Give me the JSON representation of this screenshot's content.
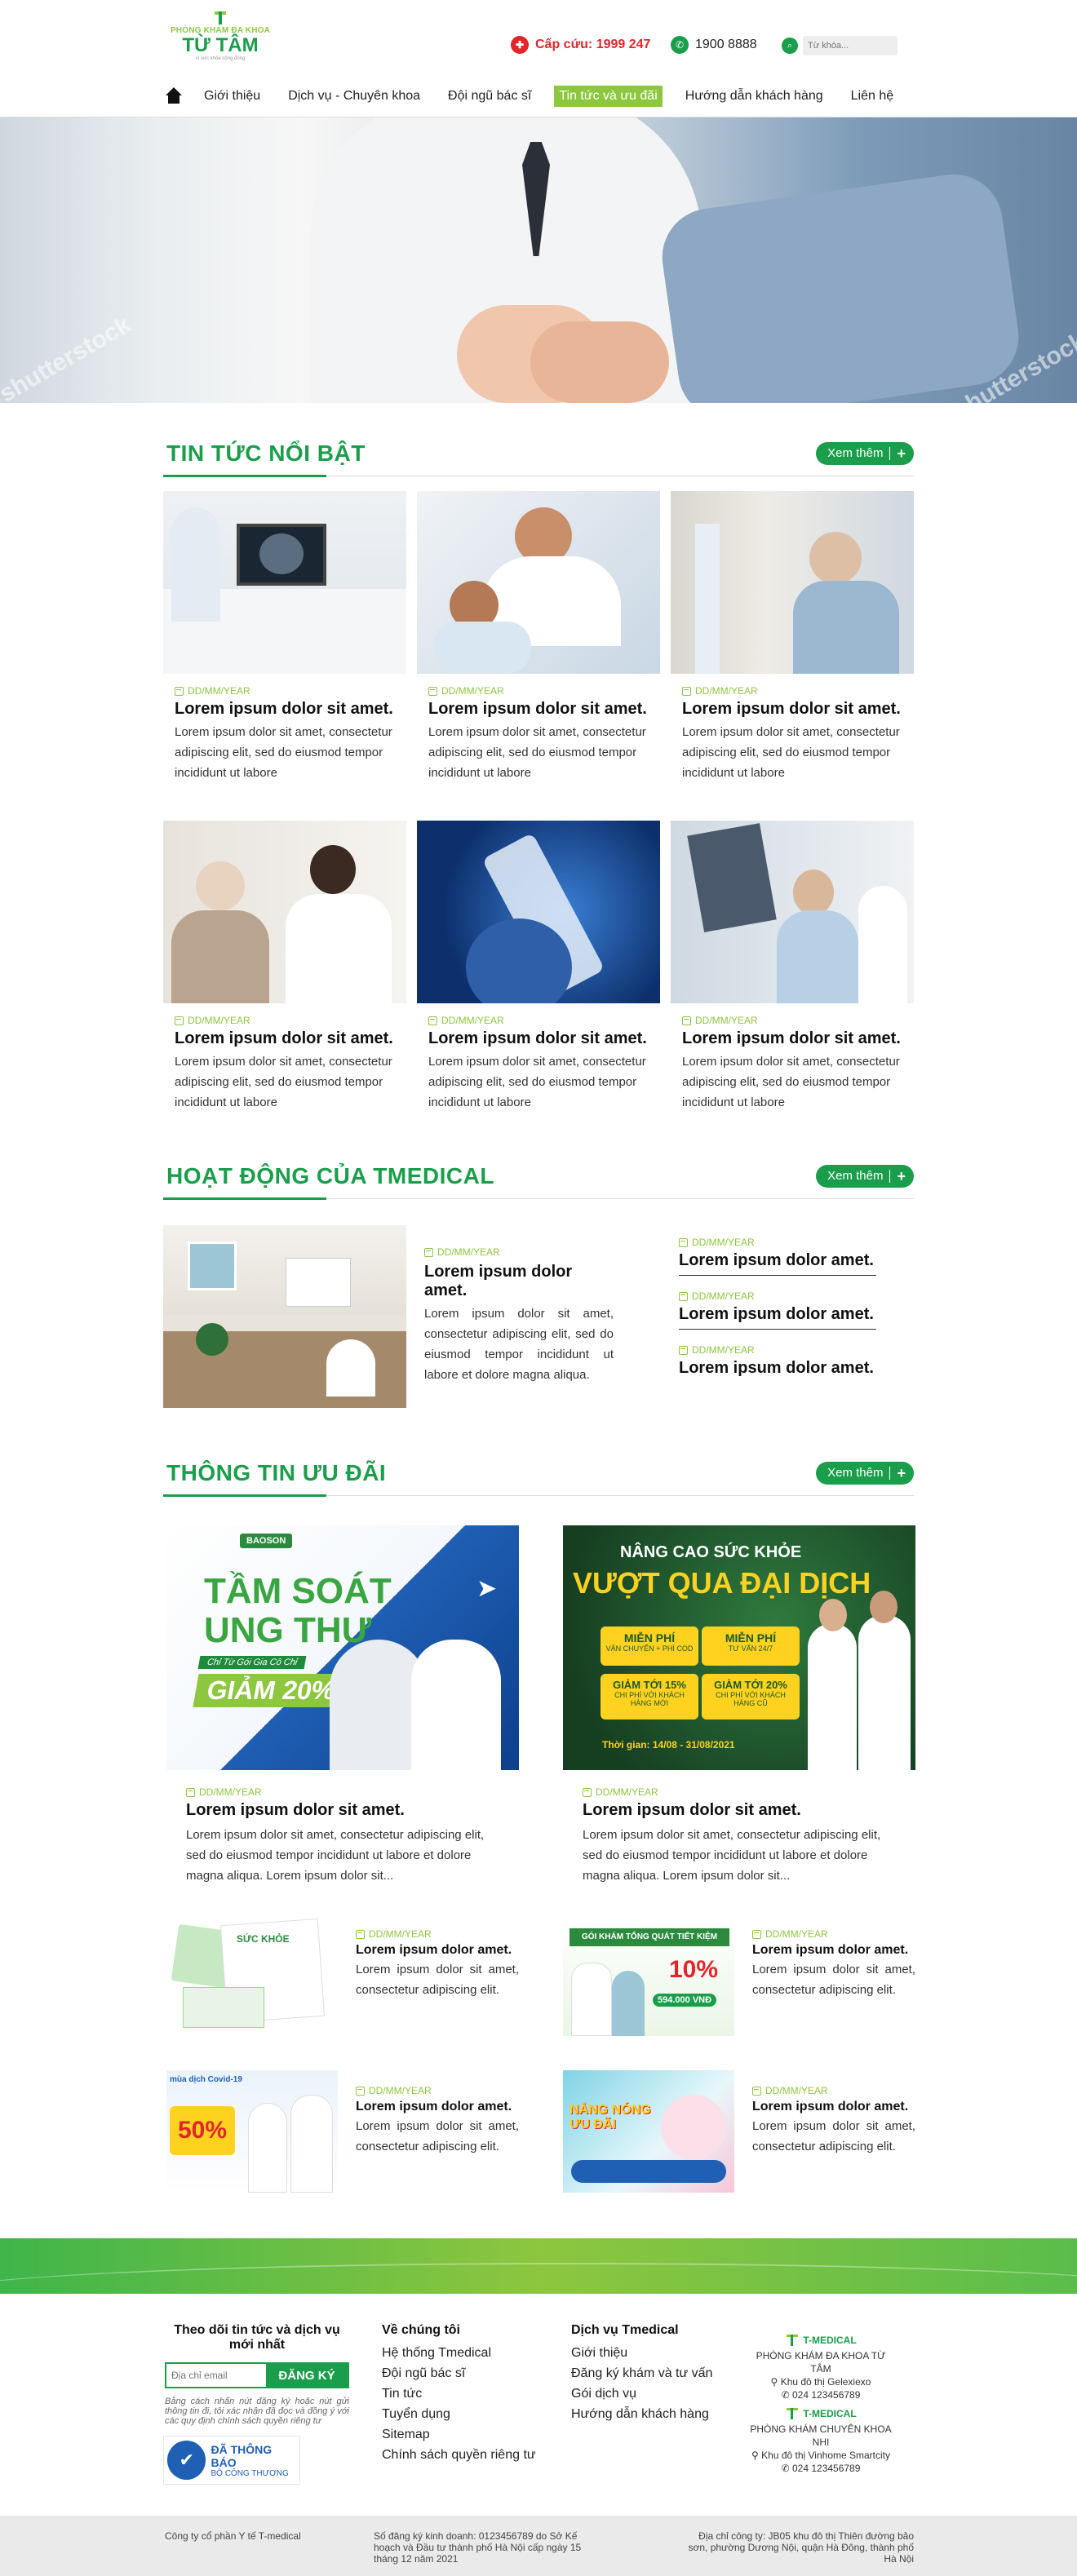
{
  "header": {
    "logo": {
      "sub": "PHÒNG KHÁM ĐA KHOA",
      "name": "TỪ TÂM",
      "tag": "vì sức khỏe cộng đồng"
    },
    "emergency": "Cấp cứu: 1999 247",
    "hotline": "1900 8888",
    "search_placeholder": "Từ khóa..."
  },
  "nav": {
    "items": [
      {
        "label": "Giới thiệu"
      },
      {
        "label": "Dịch vụ - Chuyên khoa"
      },
      {
        "label": "Đội ngũ bác sĩ"
      },
      {
        "label": "Tin tức và ưu đãi"
      },
      {
        "label": "Hướng dẫn khách hàng"
      },
      {
        "label": "Liên hệ"
      }
    ],
    "active_index": 3
  },
  "hero": {
    "watermark": "shutterstock"
  },
  "featured": {
    "title": "TIN TỨC NỔI BẬT",
    "more": "Xem thêm",
    "cards": [
      {
        "date": "DD/MM/YEAR",
        "title": "Lorem ipsum dolor sit amet.",
        "desc": "Lorem ipsum dolor sit amet, consectetur adipiscing elit, sed do eiusmod tempor incididunt ut labore",
        "image": "lab-xray-monitor"
      },
      {
        "date": "DD/MM/YEAR",
        "title": "Lorem ipsum dolor sit amet.",
        "desc": "Lorem ipsum dolor sit amet, consectetur adipiscing elit, sed do eiusmod tempor incididunt ut labore",
        "image": "mother-child-hospital"
      },
      {
        "date": "DD/MM/YEAR",
        "title": "Lorem ipsum dolor sit amet.",
        "desc": "Lorem ipsum dolor sit amet, consectetur adipiscing elit, sed do eiusmod tempor incididunt ut labore",
        "image": "elderly-patient"
      },
      {
        "date": "DD/MM/YEAR",
        "title": "Lorem ipsum dolor sit amet.",
        "desc": "Lorem ipsum dolor sit amet, consectetur adipiscing elit, sed do eiusmod tempor incididunt ut labore",
        "image": "doctor-senior-patient"
      },
      {
        "date": "DD/MM/YEAR",
        "title": "Lorem ipsum dolor sit amet.",
        "desc": "Lorem ipsum dolor sit amet, consectetur adipiscing elit, sed do eiusmod tempor incididunt ut labore",
        "image": "covid-vaccine-vial"
      },
      {
        "date": "DD/MM/YEAR",
        "title": "Lorem ipsum dolor sit amet.",
        "desc": "Lorem ipsum dolor sit amet, consectetur adipiscing elit, sed do eiusmod tempor incididunt ut labore",
        "image": "doctors-xray"
      }
    ]
  },
  "activity": {
    "title": "HOẠT ĐỘNG CỦA TMEDICAL",
    "more": "Xem thêm",
    "main": {
      "date": "DD/MM/YEAR",
      "title": "Lorem ipsum dolor amet.",
      "desc": "Lorem ipsum dolor sit amet, consectetur adipiscing elit, sed do eiusmod tempor incididunt ut labore et dolore magna aliqua."
    },
    "list": [
      {
        "date": "DD/MM/YEAR",
        "title": "Lorem ipsum dolor amet."
      },
      {
        "date": "DD/MM/YEAR",
        "title": "Lorem ipsum dolor amet."
      },
      {
        "date": "DD/MM/YEAR",
        "title": "Lorem ipsum dolor amet."
      }
    ]
  },
  "promo": {
    "title": "THÔNG TIN ƯU ĐÃI",
    "more": "Xem thêm",
    "large": [
      {
        "date": "DD/MM/YEAR",
        "title": "Lorem ipsum dolor sit amet.",
        "desc": "Lorem ipsum dolor sit amet, consectetur adipiscing elit, sed do eiusmod tempor incididunt ut labore et dolore magna aliqua. Lorem ipsum dolor sit...",
        "banner": {
          "brand": "BAOSON",
          "headline1": "TẦM SOÁT",
          "headline2": "UNG THƯ",
          "sub": "Chỉ Từ Gói Gia Cô Chỉ",
          "discount": "GIẢM 20%"
        }
      },
      {
        "date": "DD/MM/YEAR",
        "title": "Lorem ipsum dolor sit amet.",
        "desc": "Lorem ipsum dolor sit amet, consectetur adipiscing elit, sed do eiusmod tempor incididunt ut labore et dolore magna aliqua. Lorem ipsum dolor sit...",
        "banner": {
          "top": "NÂNG CAO SỨC KHỎE",
          "headline": "VƯỢT QUA ĐẠI DỊCH",
          "boxes": [
            {
              "t": "MIỄN PHÍ",
              "s": "VẬN CHUYỂN + PHÍ COD"
            },
            {
              "t": "MIỄN PHÍ",
              "s": "TƯ VẤN 24/7"
            },
            {
              "t": "GIẢM TỚI 15%",
              "s": "CHI PHÍ VỚI KHÁCH HÀNG MỚI"
            },
            {
              "t": "GIẢM TỚI 20%",
              "s": "CHI PHÍ VỚI KHÁCH HÀNG CŨ"
            }
          ],
          "time": "Thời gian: 14/08 - 31/08/2021"
        }
      }
    ],
    "small": [
      {
        "date": "DD/MM/YEAR",
        "title": "Lorem ipsum dolor amet.",
        "desc": "Lorem ipsum dolor sit amet, consectetur adipiscing elit.",
        "banner": {
          "text": "SỨC KHỎE"
        }
      },
      {
        "date": "DD/MM/YEAR",
        "title": "Lorem ipsum dolor amet.",
        "desc": "Lorem ipsum dolor sit amet, consectetur adipiscing elit.",
        "banner": {
          "text": "GÓI KHÁM TỔNG QUÁT TIẾT KIỆM",
          "pct": "10%",
          "price": "594.000 VNĐ"
        }
      },
      {
        "date": "DD/MM/YEAR",
        "title": "Lorem ipsum dolor amet.",
        "desc": "Lorem ipsum dolor sit amet, consectetur adipiscing elit.",
        "banner": {
          "text": "mùa dịch Covid-19",
          "pct": "50%"
        }
      },
      {
        "date": "DD/MM/YEAR",
        "title": "Lorem ipsum dolor amet.",
        "desc": "Lorem ipsum dolor sit amet, consectetur adipiscing elit.",
        "banner": {
          "text": "NẮNG NÓNG ƯU ĐÃI"
        }
      }
    ]
  },
  "footer": {
    "subscribe": {
      "heading": "Theo dõi tin tức và dịch vụ mới nhất",
      "placeholder": "Địa chỉ email",
      "button": "ĐĂNG KÝ",
      "note": "Bằng cách nhấn nút đăng ký hoặc nút gửi thông tin đi, tôi xác nhận đã đọc và đồng ý với các quy định chính sách quyền riêng tư"
    },
    "gov_badge": {
      "line1": "ĐÃ THÔNG BÁO",
      "line2": "BỘ CÔNG THƯƠNG"
    },
    "about": {
      "heading": "Về chúng tôi",
      "items": [
        "Hệ thống Tmedical",
        "Đội ngũ bác sĩ",
        "Tin tức",
        "Tuyển dụng",
        "Sitemap",
        "Chính sách quyền riêng tư"
      ]
    },
    "services": {
      "heading": "Dịch vụ Tmedical",
      "items": [
        "Giới thiệu",
        "Đăng ký khám và tư vấn",
        "Gói dịch vụ",
        "Hướng dẫn khách hàng"
      ]
    },
    "brands": [
      {
        "logo": "T-MEDICAL",
        "name": "PHÒNG KHÁM ĐA KHOA TỪ TÂM",
        "addr": "Khu đô thị Gelexiexo",
        "phone": "024 123456789"
      },
      {
        "logo": "T-MEDICAL",
        "name": "PHÒNG KHÁM CHUYÊN KHOA NHI",
        "addr": "Khu đô thị Vinhome Smartcity",
        "phone": "024 123456789"
      }
    ],
    "bottom": {
      "company": "Công ty cổ phần Y tế T-medical",
      "license": "Số đăng ký kinh doanh: 0123456789 do Sở Kế hoạch và Đầu tư thành phố Hà Nội cấp ngày 15 tháng 12 năm 2021",
      "address": "Địa chỉ công ty: JB05 khu đô thị Thiên đường bảo sơn, phường Dương Nội, quận Hà Đông, thành phố Hà Nội"
    }
  },
  "colors": {
    "primary": "#1a9e4b",
    "accent": "#8dc63f",
    "danger": "#e0262b"
  }
}
